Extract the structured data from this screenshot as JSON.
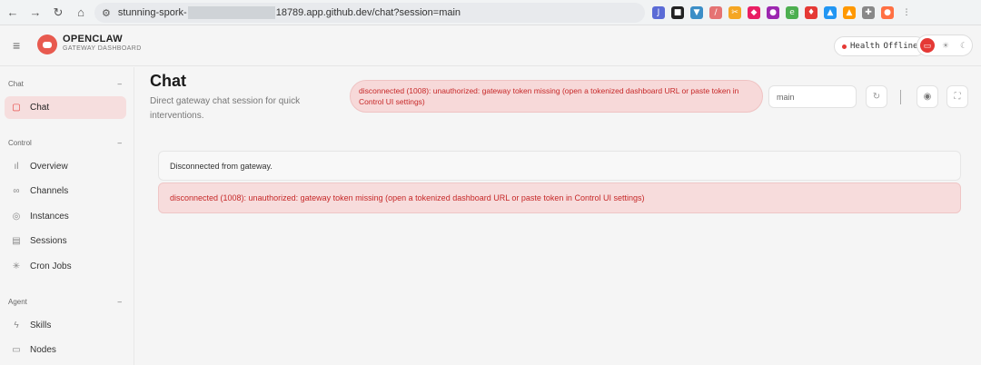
{
  "browser": {
    "url_prefix": "stunning-spork-",
    "url_suffix": "18789.app.github.dev/chat?session=main"
  },
  "header": {
    "brand_name": "OPENCLAW",
    "brand_sub": "GATEWAY DASHBOARD",
    "health_label": "Health",
    "health_status": "Offline",
    "status_color": "#e53935"
  },
  "sidebar": {
    "sections": [
      {
        "title": "Chat",
        "items": [
          {
            "label": "Chat",
            "icon": "message-square-icon",
            "active": true
          }
        ]
      },
      {
        "title": "Control",
        "items": [
          {
            "label": "Overview",
            "icon": "bar-chart-icon"
          },
          {
            "label": "Channels",
            "icon": "link-icon"
          },
          {
            "label": "Instances",
            "icon": "radio-icon"
          },
          {
            "label": "Sessions",
            "icon": "file-text-icon"
          },
          {
            "label": "Cron Jobs",
            "icon": "loader-icon"
          }
        ]
      },
      {
        "title": "Agent",
        "items": [
          {
            "label": "Skills",
            "icon": "zap-icon"
          },
          {
            "label": "Nodes",
            "icon": "monitor-icon"
          }
        ]
      }
    ]
  },
  "main": {
    "title": "Chat",
    "subtitle": "Direct gateway chat session for quick interventions.",
    "error_banner": "disconnected (1008): unauthorized: gateway token missing (open a tokenized dashboard URL or paste token in Control UI settings)",
    "session_value": "main",
    "info_message": "Disconnected from gateway.",
    "error_message": "disconnected (1008): unauthorized: gateway token missing (open a tokenized dashboard URL or paste token in Control UI settings)"
  },
  "colors": {
    "accent": "#e53935",
    "error_bg": "#f7d9d9"
  }
}
